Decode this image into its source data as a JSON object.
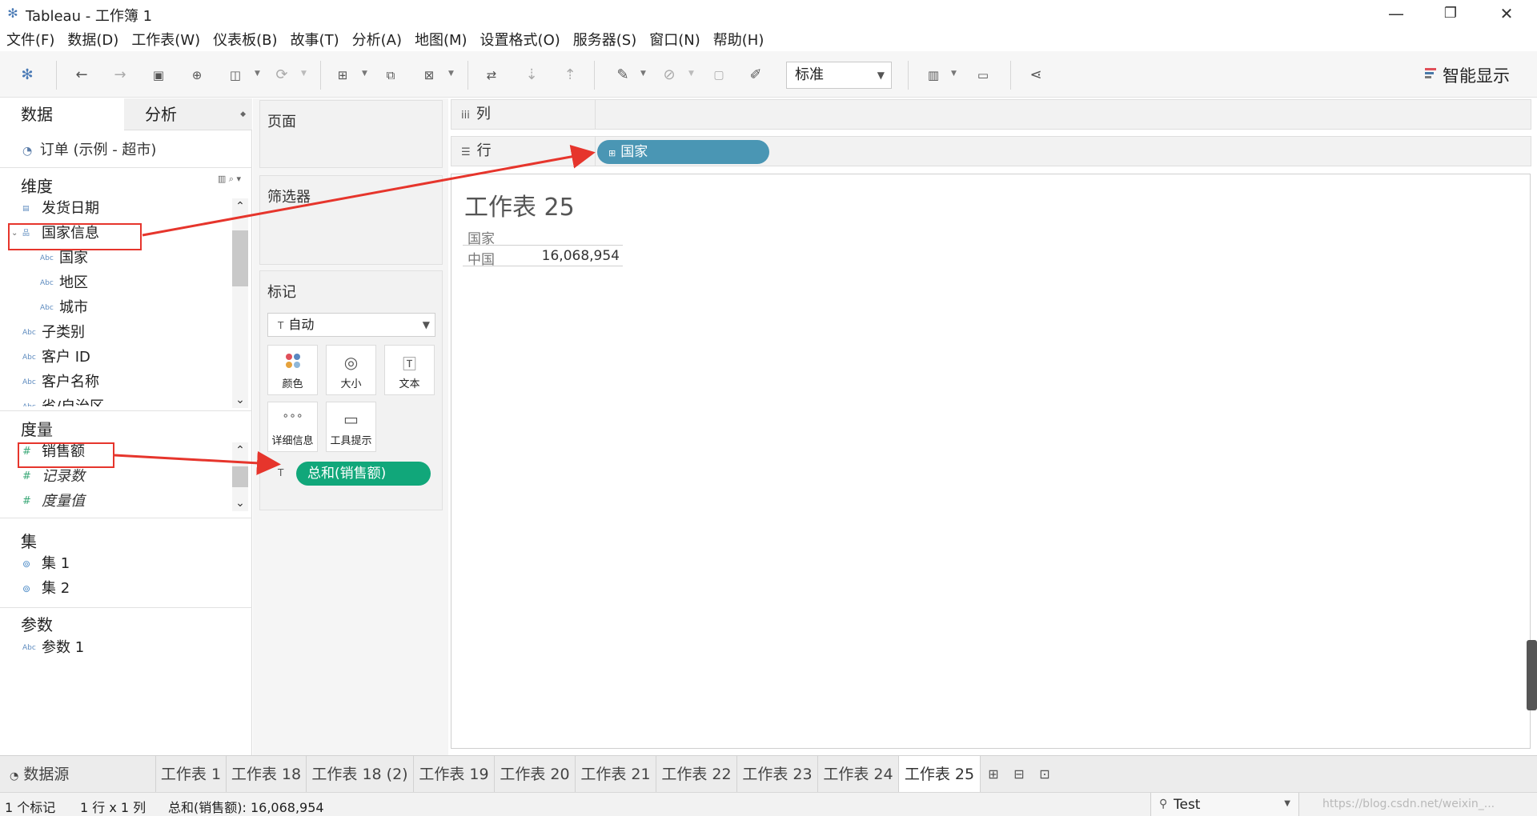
{
  "window": {
    "title": "Tableau - 工作簿 1",
    "app_icon": "tableau-logo-icon",
    "controls": [
      "—",
      "❐",
      "✕"
    ]
  },
  "menu": [
    "文件(F)",
    "数据(D)",
    "工作表(W)",
    "仪表板(B)",
    "故事(T)",
    "分析(A)",
    "地图(M)",
    "设置格式(O)",
    "服务器(S)",
    "窗口(N)",
    "帮助(H)"
  ],
  "toolbar": {
    "fit_value": "标准",
    "show_me_label": "智能显示"
  },
  "data_pane": {
    "tab_data": "数据",
    "tab_analysis": "分析",
    "datasource": "订单 (示例 - 超市)",
    "dimensions_header": "维度",
    "dimensions": [
      {
        "name": "发货日期",
        "icon": "calendar-icon",
        "glyph": "▤"
      },
      {
        "name": "国家信息",
        "icon": "hierarchy-icon",
        "glyph": "品"
      },
      {
        "name": "国家",
        "icon": "abc-icon",
        "glyph": "Abc"
      },
      {
        "name": "地区",
        "icon": "abc-icon",
        "glyph": "Abc"
      },
      {
        "name": "城市",
        "icon": "abc-icon",
        "glyph": "Abc"
      },
      {
        "name": "子类别",
        "icon": "abc-icon",
        "glyph": "Abc"
      },
      {
        "name": "客户 ID",
        "icon": "abc-icon",
        "glyph": "Abc"
      },
      {
        "name": "客户名称",
        "icon": "abc-icon",
        "glyph": "Abc"
      },
      {
        "name": "省/自治区",
        "icon": "abc-icon",
        "glyph": "Abc"
      }
    ],
    "measures_header": "度量",
    "measures": [
      {
        "name": "销售额",
        "italic": false
      },
      {
        "name": "记录数",
        "italic": true
      },
      {
        "name": "度量值",
        "italic": true
      }
    ],
    "sets_header": "集",
    "sets": [
      "集 1",
      "集 2"
    ],
    "params_header": "参数",
    "params": [
      "参数 1"
    ]
  },
  "cards": {
    "pages": "页面",
    "filters": "筛选器",
    "marks": "标记",
    "mark_type": "自动",
    "buttons": [
      "颜色",
      "大小",
      "文本",
      "详细信息",
      "工具提示"
    ],
    "text_pill": "总和(销售额)"
  },
  "shelves": {
    "columns_label": "列",
    "rows_label": "行",
    "rows_pill": "国家"
  },
  "view": {
    "title": "工作表 25",
    "column_header": "国家",
    "row_label": "中国",
    "row_value": "16,068,954"
  },
  "sheet_tabs": {
    "datasource_tab": "数据源",
    "tabs": [
      "工作表 1",
      "工作表 18",
      "工作表 18 (2)",
      "工作表 19",
      "工作表 20",
      "工作表 21",
      "工作表 22",
      "工作表 23",
      "工作表 24",
      "工作表 25"
    ],
    "active": "工作表 25"
  },
  "status": {
    "marks": "1 个标记",
    "dims": "1 行 x 1 列",
    "sum": "总和(销售额): 16,068,954",
    "user": "Test",
    "watermark": "https://blog.csdn.net/weixin_..."
  },
  "colors": {
    "annotation_red": "#e6352c",
    "dimension_pill": "#4a96b4",
    "measure_pill": "#11a77a"
  }
}
